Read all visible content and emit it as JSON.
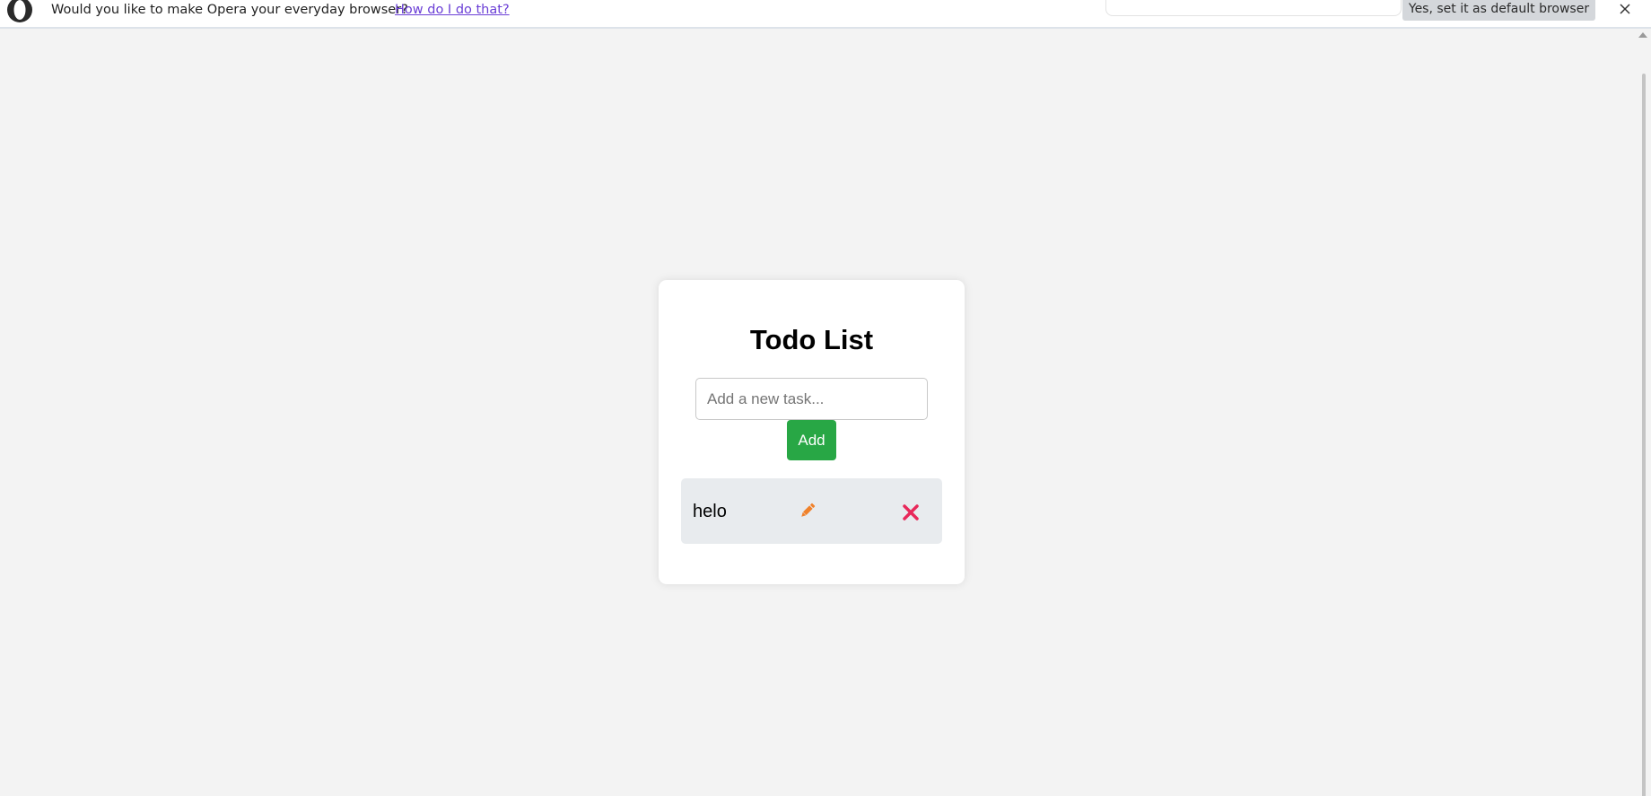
{
  "infobar": {
    "message": "Would you like to make Opera your everyday browser?",
    "link_label": "How do I do that?",
    "default_button_label": "Yes, set it as default browser",
    "colors": {
      "link": "#6b3fd6",
      "button_bg": "#d4d7db"
    }
  },
  "todo": {
    "title": "Todo List",
    "input": {
      "value": "",
      "placeholder": "Add a new task..."
    },
    "add_button_label": "Add",
    "items": [
      {
        "text": "helo"
      }
    ],
    "colors": {
      "add_button": "#28a745",
      "edit_icon": "#f0812a",
      "delete_icon": "#e8285a",
      "item_bg": "#e8ebee",
      "page_bg": "#f3f3f3"
    },
    "icons": {
      "edit": "pencil-icon",
      "delete": "cross-icon"
    }
  }
}
